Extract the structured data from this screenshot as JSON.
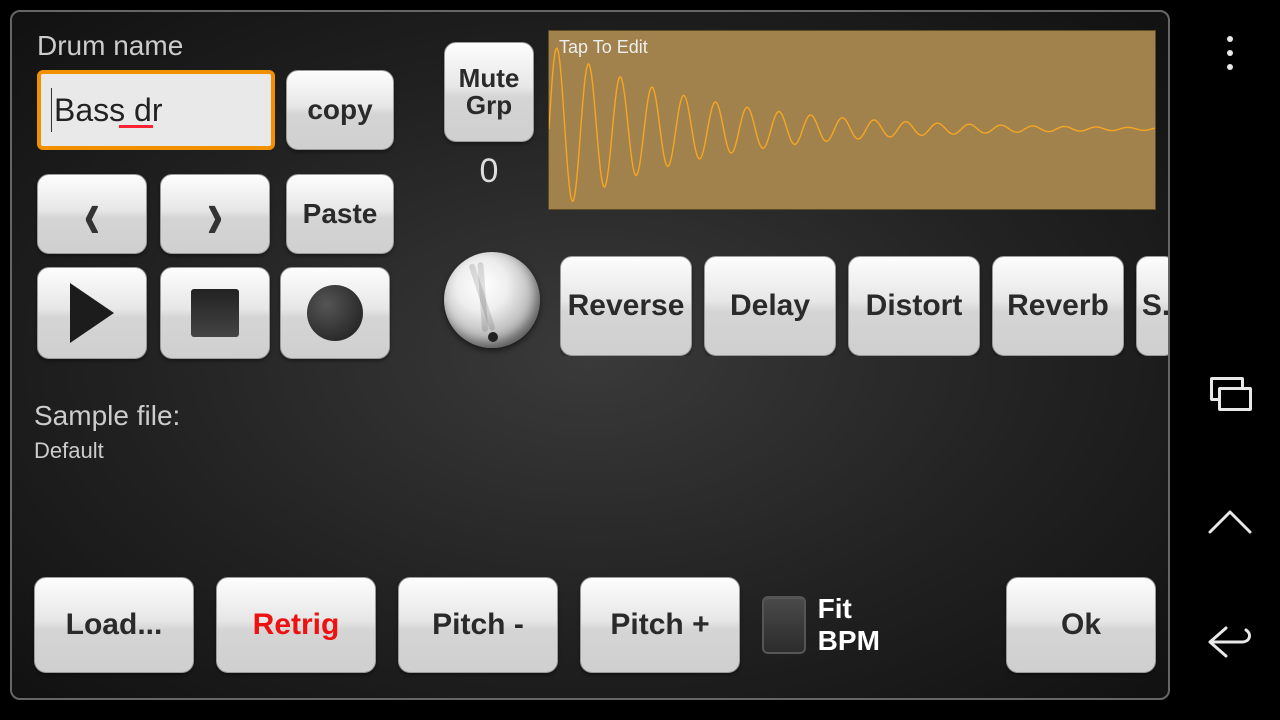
{
  "labels": {
    "drum_name": "Drum name",
    "sample_file": "Sample file:"
  },
  "drum_name_value": "Bass dr",
  "sample_file_value": "Default",
  "buttons": {
    "copy": "copy",
    "paste": "Paste",
    "mute_grp": "Mute Grp",
    "load": "Load...",
    "retrig": "Retrig",
    "pitch_minus": "Pitch -",
    "pitch_plus": "Pitch +",
    "fit_bpm": "Fit BPM",
    "ok": "Ok"
  },
  "mute_group_value": "0",
  "waveform": {
    "hint": "Tap To Edit"
  },
  "fx": [
    "Reverse",
    "Delay",
    "Distort",
    "Reverb",
    "S."
  ],
  "fit_bpm_checked": false
}
